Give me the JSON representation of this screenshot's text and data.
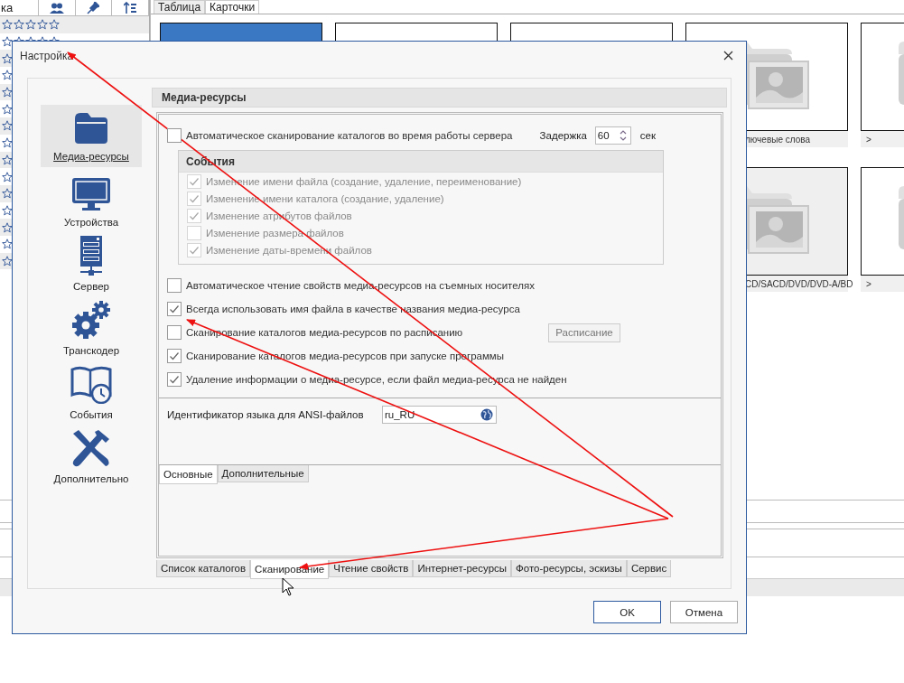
{
  "background": {
    "list_header": {
      "label": "ка"
    },
    "rating_rows": [
      {
        "stars": 0
      },
      {
        "stars": 0
      }
    ],
    "view_tabs": [
      {
        "label": "Таблица",
        "selected": false
      },
      {
        "label": "Карточки",
        "selected": true
      }
    ],
    "card_rows": [
      {
        "cards": [
          {
            "selected": true
          },
          {
            "selected": false
          },
          {
            "selected": false
          },
          {
            "selected": false,
            "caption": "лючевые слова"
          },
          {
            "selected": false,
            "caption": ">"
          }
        ]
      },
      {
        "cards": [
          {
            "selected": false,
            "caption": "CD/SACD/DVD/DVD-A/BD"
          },
          {
            "selected": false,
            "caption": ">"
          }
        ]
      }
    ]
  },
  "dialog": {
    "title": "Настройка",
    "nav": [
      {
        "label": "Медиа-ресурсы",
        "kind": "folder",
        "selected": true
      },
      {
        "label": "Устройства",
        "kind": "monitor",
        "selected": false
      },
      {
        "label": "Сервер",
        "kind": "server",
        "selected": false
      },
      {
        "label": "Транскодер",
        "kind": "gears",
        "selected": false
      },
      {
        "label": "События",
        "kind": "book",
        "selected": false
      },
      {
        "label": "Дополнительно",
        "kind": "tools",
        "selected": false
      }
    ],
    "section_title": "Медиа-ресурсы",
    "auto_scan": {
      "label": "Автоматическое сканирование каталогов во время работы сервера",
      "checked": false
    },
    "delay": {
      "label": "Задержка",
      "value": "60",
      "unit": "сек"
    },
    "events": {
      "title": "События",
      "items": [
        {
          "label": "Изменение имени файла (создание, удаление, переименование)",
          "checked": true,
          "disabled": true
        },
        {
          "label": "Изменение имени каталога (создание, удаление)",
          "checked": true,
          "disabled": true
        },
        {
          "label": "Изменение атрибутов файлов",
          "checked": true,
          "disabled": true
        },
        {
          "label": "Изменение размера файлов",
          "checked": false,
          "disabled": true
        },
        {
          "label": "Изменение даты-времени файлов",
          "checked": true,
          "disabled": true
        }
      ]
    },
    "options": [
      {
        "label": "Автоматическое чтение свойств медиа-ресурсов на съемных носителях",
        "checked": false
      },
      {
        "label": "Всегда использовать имя файла в качестве названия медиа-ресурса",
        "checked": true
      },
      {
        "label": "Сканирование каталогов медиа-ресурсов по расписанию",
        "checked": false,
        "button": {
          "label": "Расписание",
          "disabled": true
        }
      },
      {
        "label": "Сканирование каталогов медиа-ресурсов при запуске программы",
        "checked": true
      },
      {
        "label": "Удаление информации о медиа-ресурсе, если файл медиа-ресурса не найден",
        "checked": true
      }
    ],
    "language": {
      "label": "Идентификатор языка для ANSI-файлов",
      "value": "ru_RU"
    },
    "inner_tabs": [
      {
        "label": "Основные",
        "selected": true
      },
      {
        "label": "Дополнительные",
        "selected": false
      }
    ],
    "tabs": [
      {
        "label": "Список каталогов",
        "selected": false
      },
      {
        "label": "Сканирование",
        "selected": true
      },
      {
        "label": "Чтение свойств",
        "selected": false
      },
      {
        "label": "Интернет-ресурсы",
        "selected": false
      },
      {
        "label": "Фото-ресурсы, эскизы",
        "selected": false
      },
      {
        "label": "Сервис",
        "selected": false
      }
    ],
    "buttons": [
      {
        "label": "OK",
        "default": true
      },
      {
        "label": "Отмена",
        "default": false
      }
    ]
  }
}
